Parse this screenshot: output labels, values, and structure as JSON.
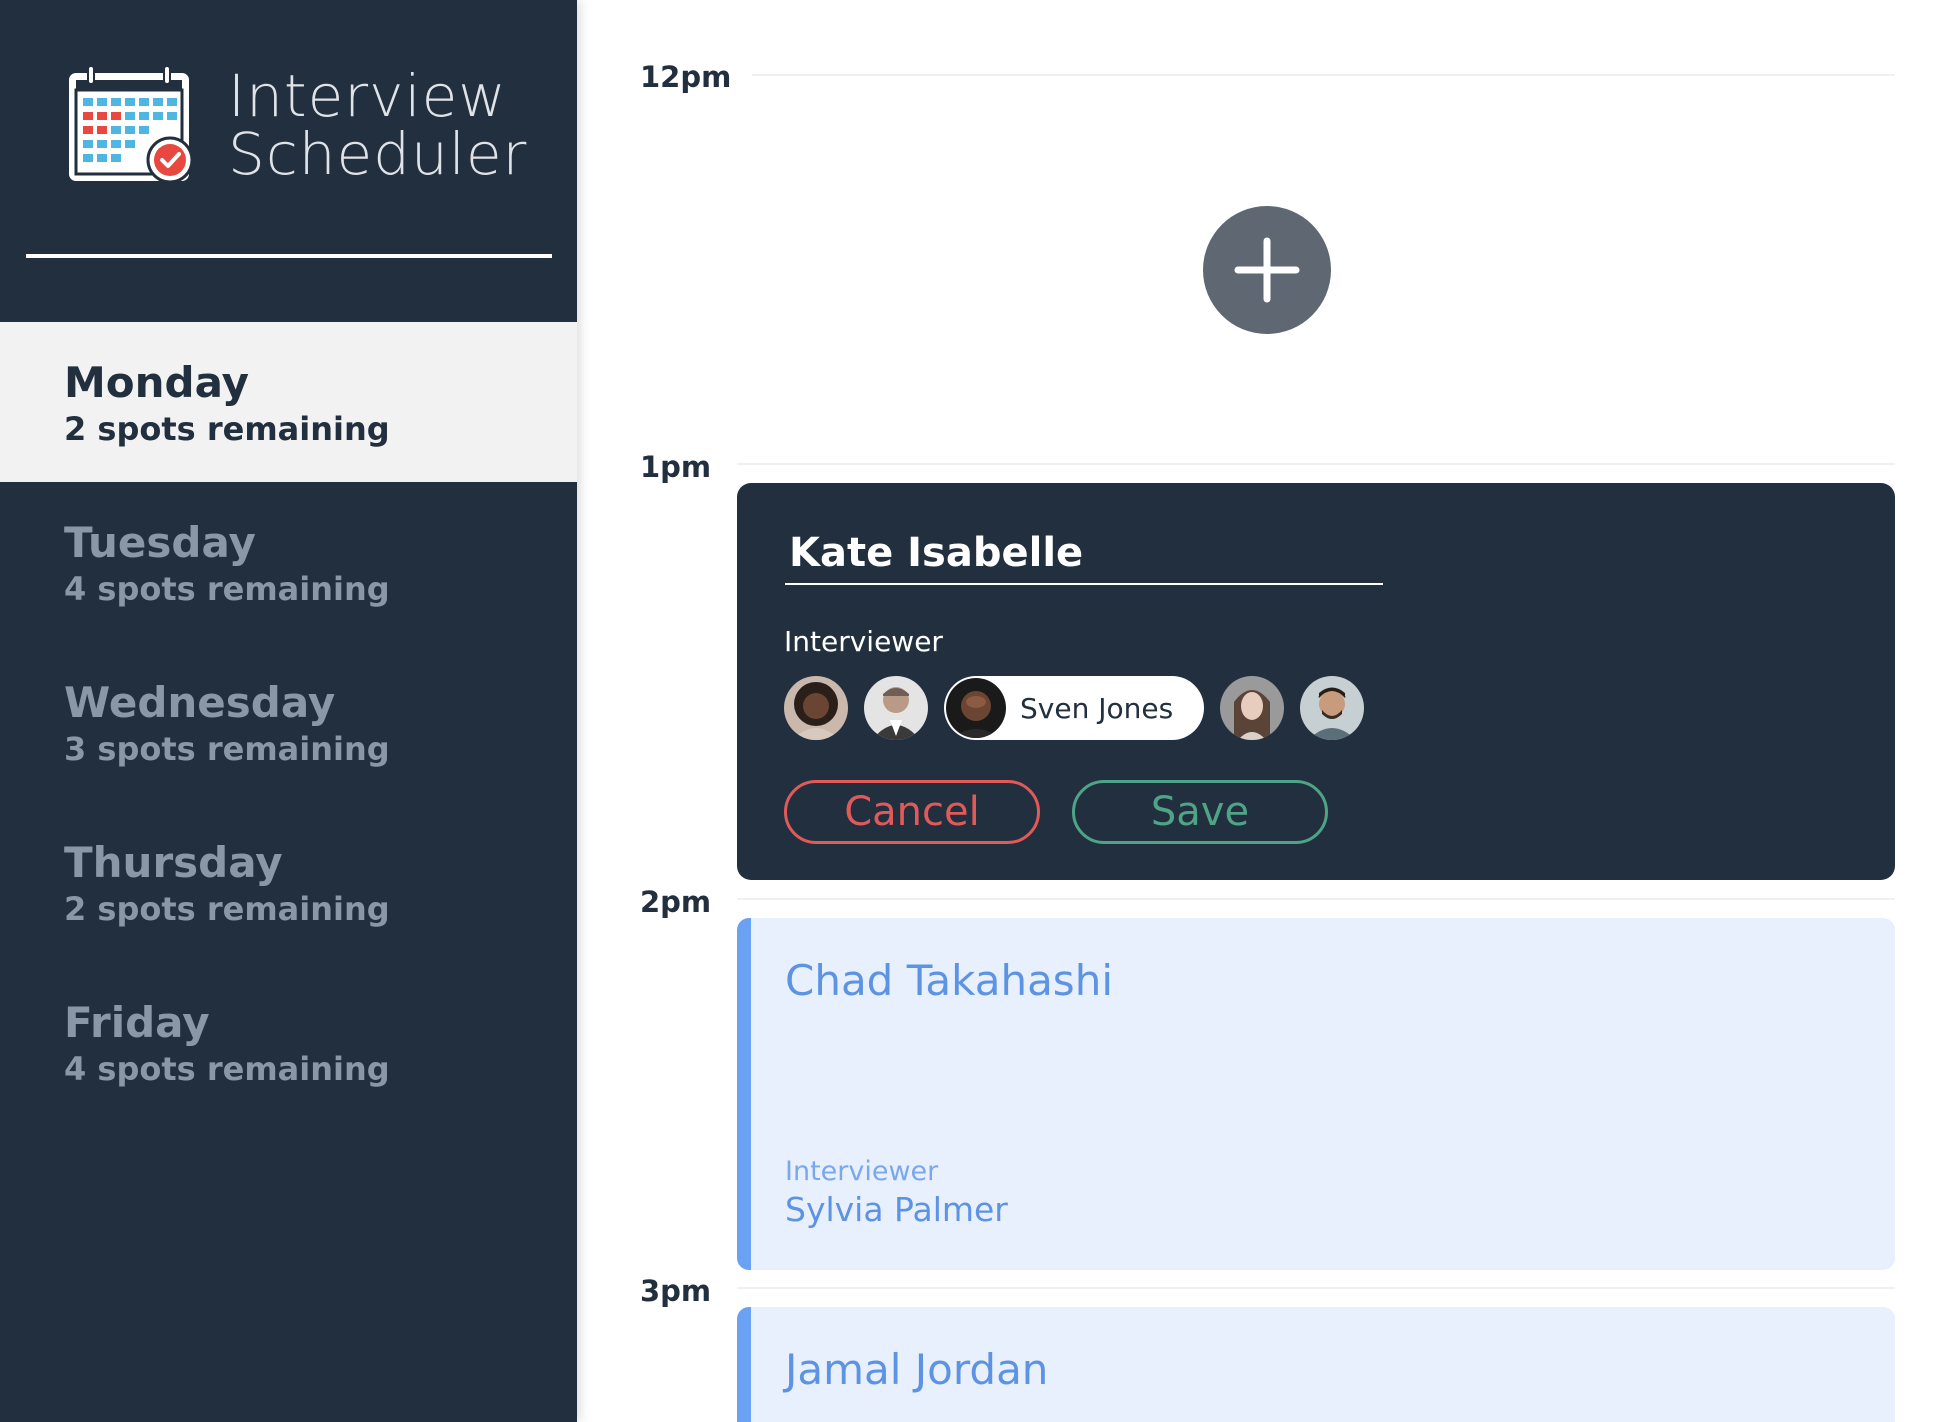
{
  "brand": {
    "title_line1": "Interview",
    "title_line2": "Scheduler",
    "logo_icon": "calendar-check-icon"
  },
  "days": [
    {
      "name": "Monday",
      "spots": "2 spots remaining",
      "selected": true
    },
    {
      "name": "Tuesday",
      "spots": "4 spots remaining",
      "selected": false
    },
    {
      "name": "Wednesday",
      "spots": "3 spots remaining",
      "selected": false
    },
    {
      "name": "Thursday",
      "spots": "2 spots remaining",
      "selected": false
    },
    {
      "name": "Friday",
      "spots": "4 spots remaining",
      "selected": false
    }
  ],
  "schedule": {
    "times": [
      "12pm",
      "1pm",
      "2pm",
      "3pm"
    ],
    "add_icon": "plus-icon",
    "edit_form": {
      "student_value": "Kate Isabelle",
      "interviewer_label": "Interviewer",
      "interviewers": [
        {
          "icon": "avatar-1"
        },
        {
          "icon": "avatar-2"
        },
        {
          "icon": "avatar-3",
          "name": "Sven Jones",
          "selected": true
        },
        {
          "icon": "avatar-4"
        },
        {
          "icon": "avatar-5"
        }
      ],
      "cancel_label": "Cancel",
      "save_label": "Save"
    },
    "appointments": [
      {
        "student": "Chad Takahashi",
        "interviewer_label": "Interviewer",
        "interviewer": "Sylvia Palmer"
      },
      {
        "student": "Jamal Jordan"
      }
    ]
  },
  "colors": {
    "sidebar": "#222f3e",
    "selected_day_bg": "#f2f2f2",
    "appointment_bg": "#e8f0fd",
    "appointment_accent": "#6aa1f2",
    "cancel": "#e05a5a",
    "save": "#4fa387",
    "add_button": "#5f6773"
  }
}
